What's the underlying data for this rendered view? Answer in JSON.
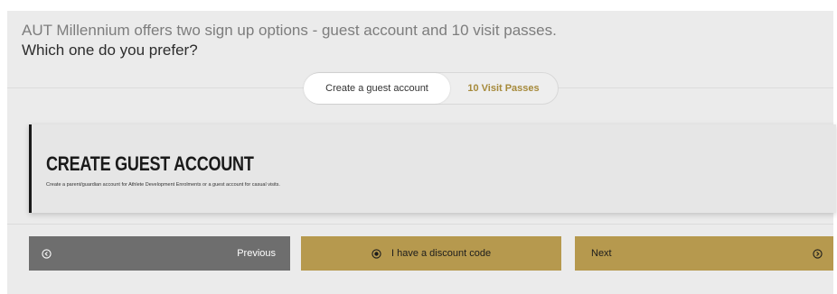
{
  "intro": {
    "line1": "AUT Millennium offers two sign up options - guest account and 10 visit passes.",
    "line2": "Which one do you prefer?"
  },
  "tabs": [
    {
      "label": "Create a guest account",
      "active": true
    },
    {
      "label": "10 Visit Passes",
      "active": false
    }
  ],
  "card": {
    "title": "CREATE GUEST ACCOUNT",
    "description": "Create a parent/guardian account for Athlete Development Enrolments or a guest account for casual visits."
  },
  "actions": {
    "previous_label": "Previous",
    "discount_label": "I have a discount code",
    "next_label": "Next"
  },
  "colors": {
    "accent_gold": "#b6994e",
    "previous_gray": "#6e6e6e",
    "tab_inactive_text": "#a68a3b"
  },
  "icons": {
    "previous": "arrow-left-circle-icon",
    "discount": "radio-dot-icon",
    "next": "arrow-right-circle-icon"
  }
}
